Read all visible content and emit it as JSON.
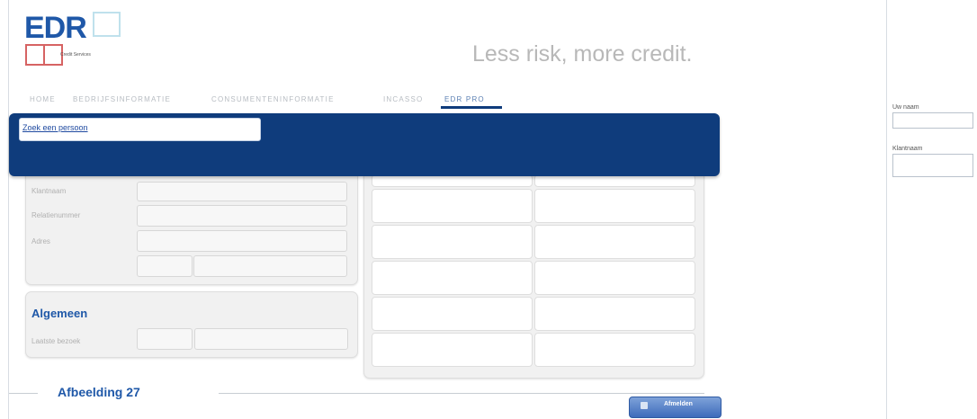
{
  "header": {
    "logo": {
      "text": "EDR",
      "subtitle": "Credit Services"
    },
    "tagline": "Less risk, more credit."
  },
  "nav": {
    "items": [
      {
        "label": "HOME",
        "active": false
      },
      {
        "label": "BEDRIJFSINFORMATIE",
        "active": false
      },
      {
        "label": "CONSUMENTENINFORMATIE",
        "active": false
      },
      {
        "label": "INCASSO",
        "active": false
      },
      {
        "label": "EDR PRO",
        "active": true
      }
    ]
  },
  "popup": {
    "search_value": "Zoek een persoon"
  },
  "form": {
    "labels": {
      "klantnaam": "Klantnaam",
      "relatienummer": "Relatienummer",
      "adres": "Adres"
    }
  },
  "algemeen": {
    "title": "Algemeen",
    "laatste_bezoek": "Laatste bezoek"
  },
  "footer": {
    "caption": "Afbeelding 27",
    "afmelden_label": "Afmelden"
  },
  "right_panel": {
    "username_label": "Uw naam",
    "klantnaam_label": "Klantnaam"
  },
  "colors": {
    "accent": "#0f3c7c",
    "brand_blue": "#1f58a8",
    "logo_red": "#d66363",
    "logo_cyan": "#bfe1ec"
  }
}
